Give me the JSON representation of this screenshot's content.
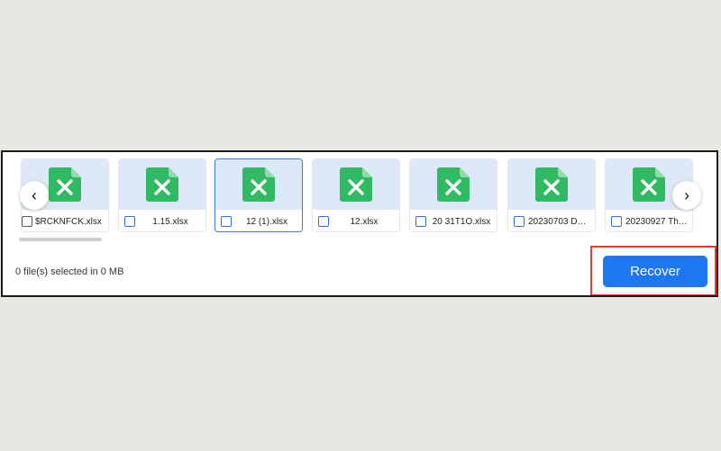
{
  "files": [
    {
      "name": "$RCKNFCK.xlsx",
      "selected": false
    },
    {
      "name": "1.15.xlsx",
      "selected": false
    },
    {
      "name": "12 (1).xlsx",
      "selected": false,
      "focused": true
    },
    {
      "name": "12.xlsx",
      "selected": false
    },
    {
      "name": "20 31T1O.xlsx",
      "selected": false
    },
    {
      "name": "20230703 DG...",
      "selected": false
    },
    {
      "name": "20230927 Tho...",
      "selected": false
    }
  ],
  "nav": {
    "prev_glyph": "‹",
    "next_glyph": "›"
  },
  "status": {
    "text": "0 file(s) selected in 0 MB"
  },
  "actions": {
    "recover_label": "Recover"
  },
  "icons": {
    "file": "excel-file-icon",
    "prev": "chevron-left-icon",
    "next": "chevron-right-icon"
  },
  "colors": {
    "accent": "#1e76f0",
    "highlight": "#e53935",
    "excel_green": "#2fba63",
    "thumb_bg": "#dde8f8"
  }
}
